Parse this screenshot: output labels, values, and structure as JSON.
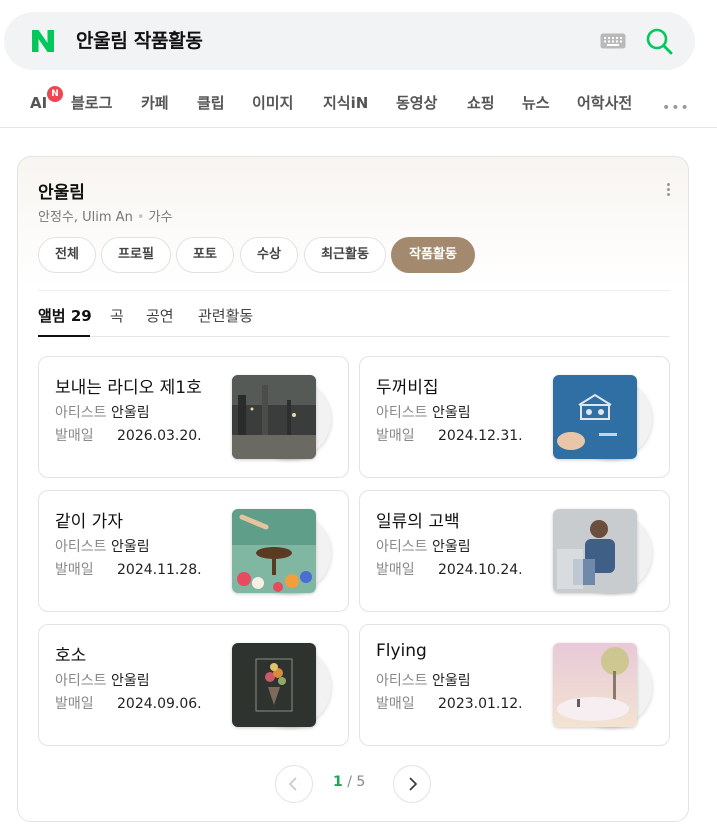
{
  "search": {
    "query": "안울림 작품활동",
    "logo_icon": "naver-n-logo",
    "brand_color": "#03c75a"
  },
  "tabs": [
    {
      "label": "AI",
      "badge": "N"
    },
    {
      "label": "블로그"
    },
    {
      "label": "카페"
    },
    {
      "label": "클립"
    },
    {
      "label": "이미지"
    },
    {
      "label": "지식iN"
    },
    {
      "label": "동영상"
    },
    {
      "label": "쇼핑"
    },
    {
      "label": "뉴스"
    },
    {
      "label": "어학사전"
    }
  ],
  "artist": {
    "name": "안울림",
    "aliases": "안정수, Ulim An",
    "role": "가수"
  },
  "chips": [
    {
      "label": "전체"
    },
    {
      "label": "프로필"
    },
    {
      "label": "포토"
    },
    {
      "label": "수상"
    },
    {
      "label": "최근활동"
    },
    {
      "label": "작품활동",
      "active": true
    }
  ],
  "subtabs": {
    "album_label": "앨범",
    "album_count": "29",
    "song": "곡",
    "performance": "공연",
    "related": "관련활동"
  },
  "albums": [
    {
      "title": "보내는 라디오 제1호",
      "artist_label": "아티스트",
      "artist": "안울림",
      "date_label": "발매일",
      "date": "2026.03.20."
    },
    {
      "title": "두꺼비집",
      "artist_label": "아티스트",
      "artist": "안울림",
      "date_label": "발매일",
      "date": "2024.12.31."
    },
    {
      "title": "같이 가자",
      "artist_label": "아티스트",
      "artist": "안울림",
      "date_label": "발매일",
      "date": "2024.11.28."
    },
    {
      "title": "일류의 고백",
      "artist_label": "아티스트",
      "artist": "안울림",
      "date_label": "발매일",
      "date": "2024.10.24."
    },
    {
      "title": "호소",
      "artist_label": "아티스트",
      "artist": "안울림",
      "date_label": "발매일",
      "date": "2024.09.06."
    },
    {
      "title": "Flying",
      "artist_label": "아티스트",
      "artist": "안울림",
      "date_label": "발매일",
      "date": "2023.01.12."
    }
  ],
  "pagination": {
    "current": "1",
    "separator": " / ",
    "total": "5"
  },
  "colors": {
    "active_chip": "#a38a6f",
    "page_current": "#19a94f",
    "ai_badge": "#ef4452"
  }
}
